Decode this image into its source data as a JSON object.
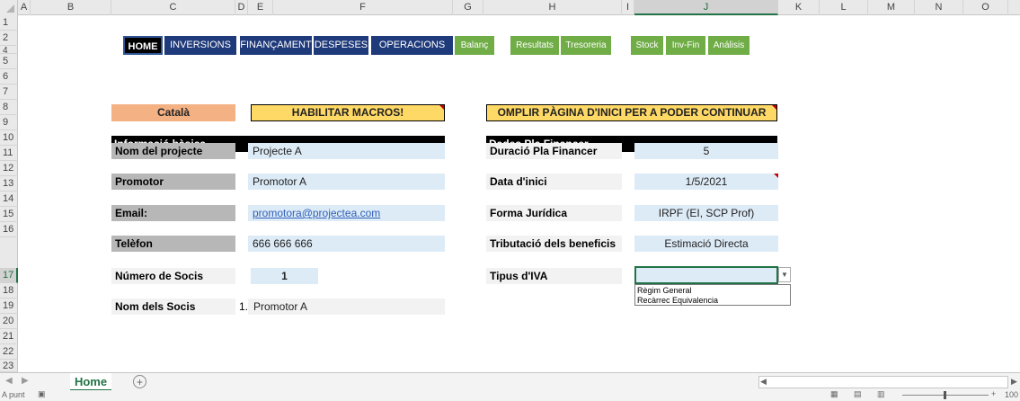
{
  "columns": [
    "A",
    "B",
    "C",
    "D",
    "E",
    "F",
    "G",
    "H",
    "I",
    "J",
    "K",
    "L",
    "M",
    "N",
    "O"
  ],
  "rows": [
    "1",
    "2",
    "4",
    "5",
    "6",
    "7",
    "8",
    "9",
    "10",
    "11",
    "12",
    "13",
    "14",
    "15",
    "16",
    "17",
    "18",
    "19",
    "20",
    "21",
    "22",
    "23"
  ],
  "nav": {
    "home": "HOME",
    "inversions": "INVERSIONS",
    "financament": "FINANÇAMENT",
    "despeses": "DESPESES",
    "operacions": "OPERACIONS",
    "balanc": "Balanç",
    "resultats": "Resultats",
    "tresoreria": "Tresoreria",
    "stock": "Stock",
    "invfin": "Inv-Fin",
    "analisis": "Análisis"
  },
  "language_button": "Català",
  "macros_button": "HABILITAR MACROS!",
  "notice": "OMPLIR PÀGINA D'INICI PER A PODER CONTINUAR",
  "basic": {
    "header": "Informació bàsica",
    "project_label": "Nom del projecte",
    "project_value": "Projecte A",
    "promoter_label": "Promotor",
    "promoter_value": "Promotor A",
    "email_label": "Email:",
    "email_value": "promotora@projectea.com",
    "phone_label": "Telèfon",
    "phone_value": "666 666 666",
    "partners_count_label": "Número de Socis",
    "partners_count_value": "1",
    "partners_names_label": "Nom dels Socis",
    "partner_index": "1.",
    "partner_name": "Promotor A"
  },
  "plan": {
    "header": "Dades Pla Financer",
    "duration_label": "Duració Pla Financer",
    "duration_value": "5",
    "start_label": "Data d'inici",
    "start_value": "1/5/2021",
    "legal_label": "Forma Jurídica",
    "legal_value": "IRPF (EI, SCP Prof)",
    "tax_label": "Tributació dels beneficis",
    "tax_value": "Estimació Directa",
    "vat_label": "Tipus d'IVA",
    "vat_value": "",
    "vat_options": [
      "Règim General",
      "Recàrrec Equivalencia"
    ]
  },
  "sheet_tab": "Home",
  "status_text": "A punt",
  "zoom_text": "100",
  "colors": {
    "nav_blue": "#1f3a7a",
    "nav_green": "#70ad47",
    "yellow": "#ffd966",
    "orange": "#f4b183",
    "value_blue": "#ddebf7"
  }
}
